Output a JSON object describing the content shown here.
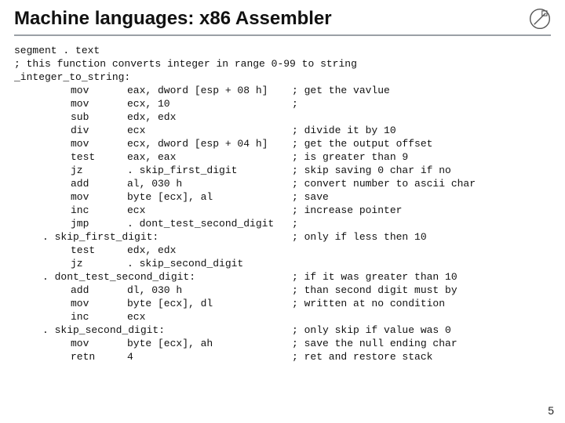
{
  "title": "Machine languages: x86 Assembler",
  "segment_line": "segment . text",
  "header_comment": "; this function converts integer in range 0-99 to string",
  "label_main": "_integer_to_string:",
  "label_sfd": ". skip_first_digit:",
  "label_dtsd": ". dont_test_second_digit:",
  "label_ssd": ". skip_second_digit:",
  "ops": {
    "l1": {
      "op": "mov",
      "arg": "eax, dword [esp + 08 h]",
      "c": "; get the vavlue"
    },
    "l2": {
      "op": "mov",
      "arg": "ecx, 10",
      "c": ";"
    },
    "l3": {
      "op": "sub",
      "arg": "edx, edx",
      "c": ""
    },
    "l4": {
      "op": "div",
      "arg": "ecx",
      "c": "; divide it by 10"
    },
    "l5": {
      "op": "mov",
      "arg": "ecx, dword [esp + 04 h]",
      "c": "; get the output offset"
    },
    "l6": {
      "op": "test",
      "arg": "eax, eax",
      "c": "; is greater than 9"
    },
    "l7": {
      "op": "jz",
      "arg": ". skip_first_digit",
      "c": "; skip saving 0 char if no"
    },
    "l8": {
      "op": "add",
      "arg": "al, 030 h",
      "c": "; convert number to ascii char"
    },
    "l9": {
      "op": "mov",
      "arg": "byte [ecx], al",
      "c": "; save"
    },
    "l10": {
      "op": "inc",
      "arg": "ecx",
      "c": "; increase pointer"
    },
    "l11": {
      "op": "jmp",
      "arg": ". dont_test_second_digit",
      "c": ";"
    },
    "sfd_c": "; only if less then 10",
    "l12": {
      "op": "test",
      "arg": "edx, edx",
      "c": ""
    },
    "l13": {
      "op": "jz",
      "arg": ". skip_second_digit",
      "c": ""
    },
    "dtsd_c": "; if it was greater than 10",
    "l14": {
      "op": "add",
      "arg": "dl, 030 h",
      "c": "; than second digit must by"
    },
    "l15": {
      "op": "mov",
      "arg": "byte [ecx], dl",
      "c": "; written at no condition"
    },
    "l16": {
      "op": "inc",
      "arg": "ecx",
      "c": ""
    },
    "ssd_c": "; only skip if value was 0",
    "l17": {
      "op": "mov",
      "arg": "byte [ecx], ah",
      "c": "; save the null ending char"
    },
    "l18": {
      "op": "retn",
      "arg": "4",
      "c": "; ret and restore stack"
    }
  },
  "page_number": "5"
}
